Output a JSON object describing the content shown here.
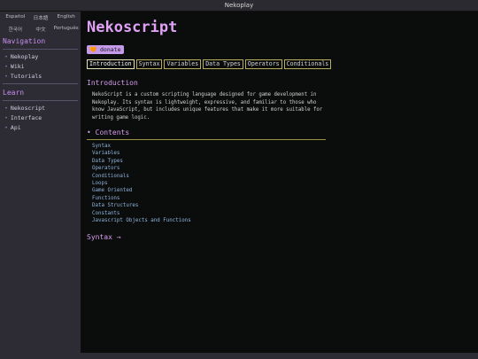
{
  "window": {
    "title": "Nekoplay"
  },
  "languages": [
    "Español",
    "日本語",
    "English",
    "한국어",
    "中文",
    "Português"
  ],
  "sidebar": {
    "navigation": {
      "heading": "Navigation",
      "items": [
        "Nekoplay",
        "Wiki",
        "Tutorials"
      ]
    },
    "learn": {
      "heading": "Learn",
      "items": [
        "Nekoscript",
        "Interface",
        "Api"
      ]
    },
    "bullet": "•"
  },
  "page": {
    "title": "Nekoscript",
    "donate_label": "🧡 donate",
    "tabs": [
      "Introduction",
      "Syntax",
      "Variables",
      "Data Types",
      "Operators",
      "Conditionals"
    ],
    "intro_heading": "Introduction",
    "intro_text": "NekoScript is a custom scripting language designed for game development in Nekoplay. Its syntax is lightweight, expressive, and familiar to those who know JavaScript, but includes unique features that make it more suitable for writing game logic.",
    "contents_heading": "Contents",
    "contents_bullet": "•",
    "toc": [
      "Syntax",
      "Variables",
      "Data Types",
      "Operators",
      "Conditionals",
      "Loops",
      "Game Oriented",
      "Functions",
      "Data Structures",
      "Constants",
      "Javascript Objects and Functions"
    ],
    "next_link": "Syntax →"
  },
  "colors": {
    "accent": "#d79cf0",
    "tab_border": "#b7ad5a",
    "link": "#8fb3df"
  }
}
